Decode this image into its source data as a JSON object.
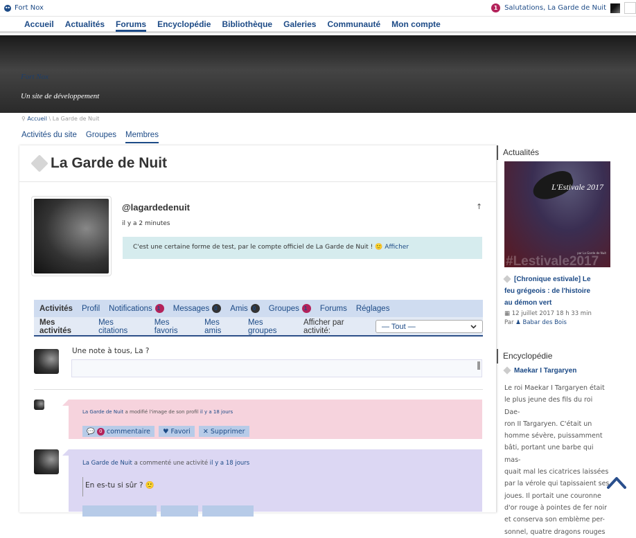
{
  "adminbar": {
    "site_name": "Fort Nox",
    "notif_count": "1",
    "greeting": "Salutations, La Garde de Nuit"
  },
  "mainnav": {
    "items": [
      "Accueil",
      "Actualités",
      "Forums",
      "Encyclopédie",
      "Bibliothèque",
      "Galeries",
      "Communauté",
      "Mon compte"
    ]
  },
  "banner": {
    "title": "Fort Nox",
    "tagline": "Un site de développement"
  },
  "breadcrumb": {
    "home": "Accueil",
    "sep": "\\",
    "current": "La Garde de Nuit"
  },
  "bp_tabs": [
    "Activités du site",
    "Groupes",
    "Membres"
  ],
  "page_title": "La Garde de Nuit",
  "profile": {
    "handle": "@lagardedenuit",
    "last_active": "il y a 2 minutes",
    "update_text": "C'est une certaine forme de test, par le compte officiel de La Garde de Nuit !",
    "update_link": "Afficher",
    "up_arrow": "↑"
  },
  "member_nav": {
    "activites": "Activités",
    "profil": "Profil",
    "notifications": "Notifications",
    "notifications_count": "1",
    "messages": "Messages",
    "messages_count": "0",
    "amis": "Amis",
    "amis_count": "0",
    "groupes": "Groupes",
    "groupes_count": "1",
    "forums": "Forums",
    "reglages": "Réglages"
  },
  "sub_nav": {
    "items": [
      "Mes activités",
      "Mes citations",
      "Mes favoris",
      "Mes amis",
      "Mes groupes"
    ],
    "filter_label": "Afficher par activité:",
    "filter_value": "— Tout —"
  },
  "post_form": {
    "prompt": "Une note à tous, La ?"
  },
  "activity1": {
    "author": "La Garde de Nuit",
    "action": "a modifié l'image de son profil",
    "time": "il y a 18 jours",
    "comment_count": "0",
    "comment_label": "commentaire",
    "favori": "Favori",
    "supprimer": "Supprimer"
  },
  "activity2": {
    "author": "La Garde de Nuit",
    "action": "a commenté une activité",
    "time": "il y a 18 jours",
    "content": "En es-tu si sûr ?"
  },
  "sidebar": {
    "actu_title": "Actualités",
    "actu_image_caption": "L'Estivale 2017",
    "actu_image_watermark": "#Lestivale2017",
    "actu_image_small": "par La Garde de Nuit",
    "actu_post_line1": "[Chronique estivale] Le",
    "actu_post_line2": "feu grégeois : de l'histoire",
    "actu_post_line3": "au démon vert",
    "actu_date": "12 juillet 2017 18 h 33 min",
    "actu_by": "Par",
    "actu_author": "Babar des Bois",
    "ency_title": "Encyclopédie",
    "ency_post": "Maekar I Targaryen",
    "ency_lines": [
      "Le roi Maekar I Targaryen était",
      "le plus jeune des fils du roi Dae-",
      "ron II Targaryen. C'était un",
      "homme sévère, puissamment",
      "bâti, portant une barbe qui mas-",
      "quait mal les cicatrices laissées",
      "par la vérole qui tapissaient ses",
      "joues. Il portait une couronne",
      "d'or rouge à pointes de fer noir",
      "et conserva son emblème per-",
      "sonnel, quatre dragons rouges"
    ]
  },
  "colors": {
    "link": "#1c4a86",
    "badge": "#b3225a",
    "activity_pink": "#f6d3dd",
    "activity_purple": "#dcd7f3",
    "quote": "#d6ecee"
  }
}
